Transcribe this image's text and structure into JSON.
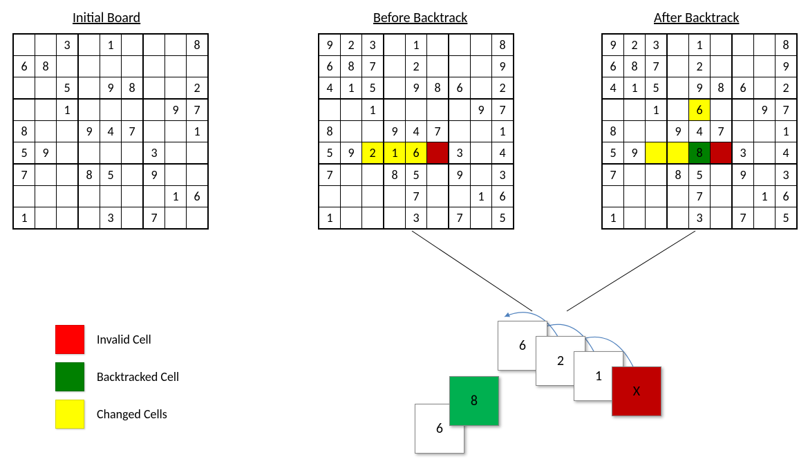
{
  "titles": {
    "initial": "Initial Board",
    "before": "Before Backtrack",
    "after": "After Backtrack"
  },
  "legend": {
    "invalid": "Invalid Cell",
    "backtracked": "Backtracked Cell",
    "changed": "Changed Cells"
  },
  "boards": {
    "initial": [
      [
        "",
        "",
        "3",
        "",
        "1",
        "",
        "",
        "",
        "8"
      ],
      [
        "6",
        "8",
        "",
        "",
        "",
        "",
        "",
        "",
        ""
      ],
      [
        "",
        "",
        "5",
        "",
        "9",
        "8",
        "",
        "",
        "2"
      ],
      [
        "",
        "",
        "1",
        "",
        "",
        "",
        "",
        "9",
        "7"
      ],
      [
        "8",
        "",
        "",
        "9",
        "4",
        "7",
        "",
        "",
        "1"
      ],
      [
        "5",
        "9",
        "",
        "",
        "",
        "",
        "3",
        "",
        ""
      ],
      [
        "7",
        "",
        "",
        "8",
        "5",
        "",
        "9",
        "",
        ""
      ],
      [
        "",
        "",
        "",
        "",
        "",
        "",
        "",
        "1",
        "6"
      ],
      [
        "1",
        "",
        "",
        "",
        "3",
        "",
        "7",
        "",
        ""
      ]
    ],
    "before": [
      [
        "9",
        "2",
        "3",
        "",
        "1",
        "",
        "",
        "",
        "8"
      ],
      [
        "6",
        "8",
        "7",
        "",
        "2",
        "",
        "",
        "",
        "9"
      ],
      [
        "4",
        "1",
        "5",
        "",
        "9",
        "8",
        "6",
        "",
        "2"
      ],
      [
        "",
        "",
        "1",
        "",
        "",
        "",
        "",
        "9",
        "7"
      ],
      [
        "8",
        "",
        "",
        "9",
        "4",
        "7",
        "",
        "",
        "1"
      ],
      [
        "5",
        "9",
        "2",
        "1",
        "6",
        "",
        "3",
        "",
        "4"
      ],
      [
        "7",
        "",
        "",
        "8",
        "5",
        "",
        "9",
        "",
        "3"
      ],
      [
        "",
        "",
        "",
        "",
        "7",
        "",
        "",
        "1",
        "6"
      ],
      [
        "1",
        "",
        "",
        "",
        "3",
        "",
        "7",
        "",
        "5"
      ]
    ],
    "after": [
      [
        "9",
        "2",
        "3",
        "",
        "1",
        "",
        "",
        "",
        "8"
      ],
      [
        "6",
        "8",
        "7",
        "",
        "2",
        "",
        "",
        "",
        "9"
      ],
      [
        "4",
        "1",
        "5",
        "",
        "9",
        "8",
        "6",
        "",
        "2"
      ],
      [
        "",
        "",
        "1",
        "",
        "6",
        "",
        "",
        "9",
        "7"
      ],
      [
        "8",
        "",
        "",
        "9",
        "4",
        "7",
        "",
        "",
        "1"
      ],
      [
        "5",
        "9",
        "",
        "",
        "8",
        "",
        "3",
        "",
        "4"
      ],
      [
        "7",
        "",
        "",
        "8",
        "5",
        "",
        "9",
        "",
        "3"
      ],
      [
        "",
        "",
        "",
        "",
        "7",
        "",
        "",
        "1",
        "6"
      ],
      [
        "1",
        "",
        "",
        "",
        "3",
        "",
        "7",
        "",
        "5"
      ]
    ]
  },
  "highlights": {
    "before": {
      "5,2": "c-yellow",
      "5,3": "c-yellow",
      "5,4": "c-yellow",
      "5,5": "c-red"
    },
    "after": {
      "3,4": "c-yellow",
      "5,2": "c-yellow",
      "5,3": "c-yellow",
      "5,4": "c-green",
      "5,5": "c-red"
    }
  },
  "stack": {
    "cards": [
      "6",
      "8",
      "6",
      "2",
      "1",
      "X"
    ],
    "green_value": "8",
    "red_value": "X"
  }
}
